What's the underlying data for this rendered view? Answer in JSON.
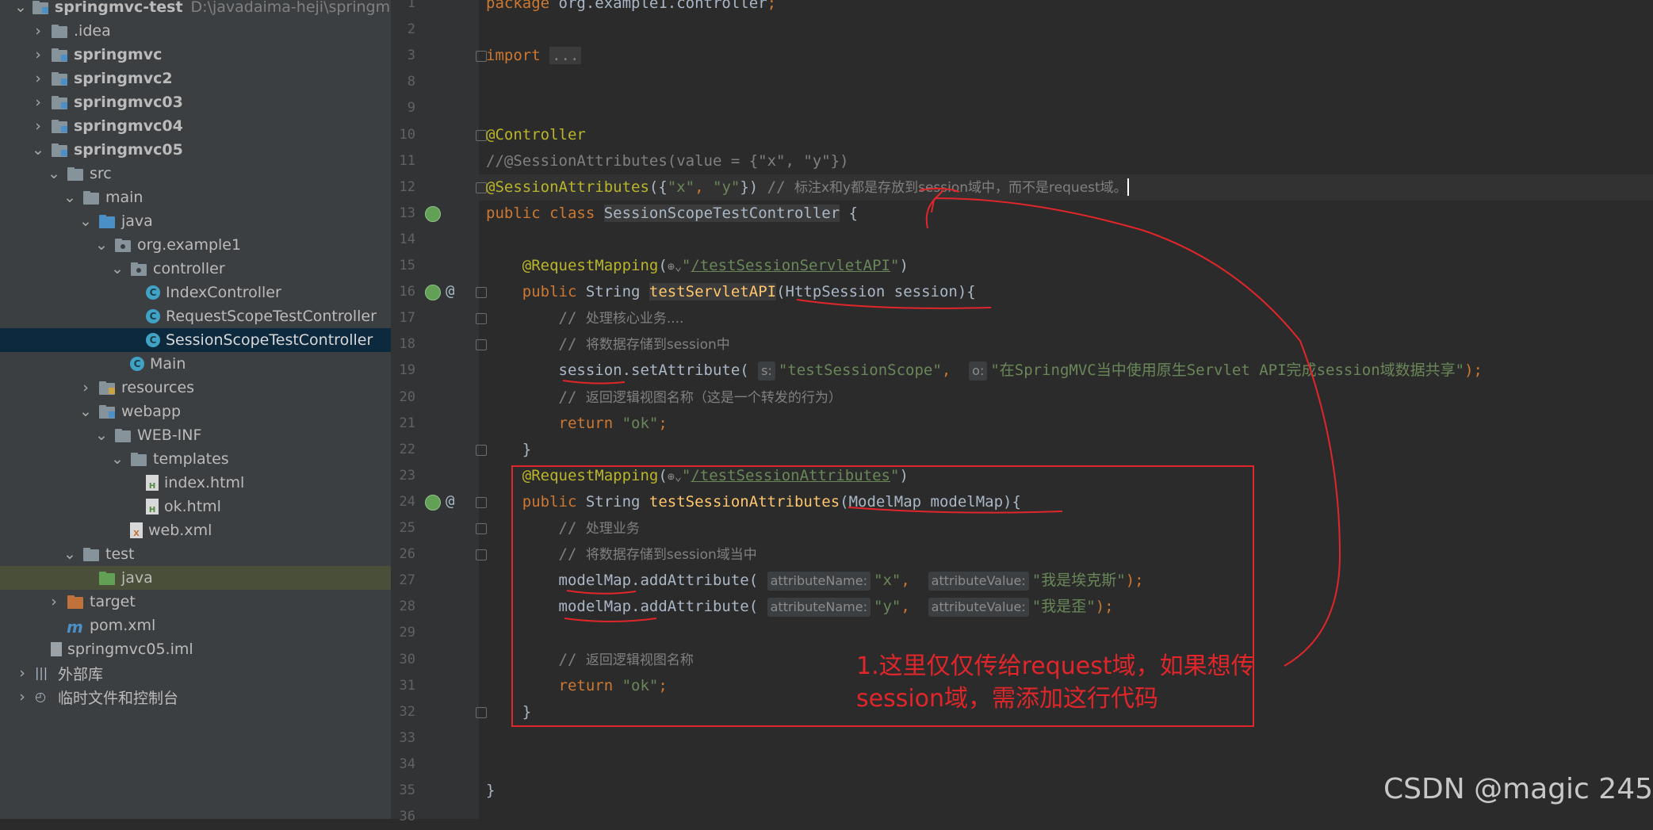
{
  "project_tree": {
    "items": [
      {
        "label": "springmvc-test",
        "path": "D:\\javadaima-heji\\springmvc-test",
        "icon": "module-folder-icon",
        "arrow": "down",
        "depth": 0,
        "bold": true
      },
      {
        "label": ".idea",
        "icon": "folder-icon",
        "arrow": "right",
        "depth": 1
      },
      {
        "label": "springmvc",
        "icon": "module-folder-icon",
        "arrow": "right",
        "depth": 1,
        "bold": true
      },
      {
        "label": "springmvc2",
        "icon": "module-folder-icon",
        "arrow": "right",
        "depth": 1,
        "bold": true
      },
      {
        "label": "springmvc03",
        "icon": "module-folder-icon",
        "arrow": "right",
        "depth": 1,
        "bold": true
      },
      {
        "label": "springmvc04",
        "icon": "module-folder-icon",
        "arrow": "right",
        "depth": 1,
        "bold": true
      },
      {
        "label": "springmvc05",
        "icon": "module-folder-icon",
        "arrow": "down",
        "depth": 1,
        "bold": true
      },
      {
        "label": "src",
        "icon": "folder-icon",
        "arrow": "down",
        "depth": 2
      },
      {
        "label": "main",
        "icon": "folder-icon",
        "arrow": "down",
        "depth": 3
      },
      {
        "label": "java",
        "icon": "source-folder-icon",
        "arrow": "down",
        "depth": 4
      },
      {
        "label": "org.example1",
        "icon": "package-icon",
        "arrow": "down",
        "depth": 5
      },
      {
        "label": "controller",
        "icon": "package-icon",
        "arrow": "down",
        "depth": 6
      },
      {
        "label": "IndexController",
        "icon": "class-icon",
        "arrow": "none",
        "depth": 7
      },
      {
        "label": "RequestScopeTestController",
        "icon": "class-icon",
        "arrow": "none",
        "depth": 7
      },
      {
        "label": "SessionScopeTestController",
        "icon": "class-icon",
        "arrow": "none",
        "depth": 7,
        "selected": true
      },
      {
        "label": "Main",
        "icon": "class-icon",
        "arrow": "none",
        "depth": 6
      },
      {
        "label": "resources",
        "icon": "resources-folder-icon",
        "arrow": "right",
        "depth": 4
      },
      {
        "label": "webapp",
        "icon": "web-folder-icon",
        "arrow": "down",
        "depth": 4
      },
      {
        "label": "WEB-INF",
        "icon": "folder-icon",
        "arrow": "down",
        "depth": 5
      },
      {
        "label": "templates",
        "icon": "folder-icon",
        "arrow": "down",
        "depth": 6
      },
      {
        "label": "index.html",
        "icon": "html-file-icon",
        "arrow": "none",
        "depth": 7
      },
      {
        "label": "ok.html",
        "icon": "html-file-icon",
        "arrow": "none",
        "depth": 7
      },
      {
        "label": "web.xml",
        "icon": "xml-file-icon",
        "arrow": "none",
        "depth": 6
      },
      {
        "label": "test",
        "icon": "folder-icon",
        "arrow": "down",
        "depth": 3
      },
      {
        "label": "java",
        "icon": "test-folder-icon",
        "arrow": "none",
        "depth": 4,
        "highlight": true
      },
      {
        "label": "target",
        "icon": "excluded-folder-icon",
        "arrow": "right",
        "depth": 2
      },
      {
        "label": "pom.xml",
        "icon": "maven-file-icon",
        "arrow": "none",
        "depth": 2
      },
      {
        "label": "springmvc05.iml",
        "icon": "iml-file-icon",
        "arrow": "none",
        "depth": 1
      },
      {
        "label": "外部库",
        "icon": "library-icon",
        "arrow": "right",
        "depth": 0
      },
      {
        "label": "临时文件和控制台",
        "icon": "scratches-icon",
        "arrow": "right",
        "depth": 0
      }
    ]
  },
  "editor": {
    "lines": [
      {
        "n": "1",
        "html": "<span class=\"kw\">package</span> org.example1.controller<span class=\"kw\">;</span>"
      },
      {
        "n": "2",
        "html": ""
      },
      {
        "n": "3",
        "html": "<span class=\"kw\">import</span> <span class=\"collapsed-dots\">...</span>"
      },
      {
        "n": "8",
        "html": ""
      },
      {
        "n": "9",
        "html": ""
      },
      {
        "n": "10",
        "html": "<span class=\"ann\">@Controller</span>"
      },
      {
        "n": "11",
        "html": "<span class=\"cmt\">//@SessionAttributes(value = {\"x\", \"y\"})</span>"
      },
      {
        "n": "12",
        "html": "<span class=\"ann\">@SessionAttributes</span>({<span class=\"str\">\"x\"</span><span class=\"kw\">, </span><span class=\"str\">\"y\"</span>}) <span class=\"cmt\">// </span><span class=\"cmt-zh\">标注x和y都是存放到session域中，而不是request域。</span><span class=\"caret\"></span>"
      },
      {
        "n": "13",
        "html": "<span class=\"kw\">public class</span> <span class=\"hl2\">SessionScopeTestController</span> {"
      },
      {
        "n": "14",
        "html": ""
      },
      {
        "n": "15",
        "html": "    <span class=\"ann\">@RequestMapping</span>(<span class=\"globe\">⊕⌄</span><span class=\"str\">\"</span><span class=\"url\">/testSessionServletAPI</span><span class=\"str\">\"</span>)"
      },
      {
        "n": "16",
        "html": "    <span class=\"kw\">public</span> String <span class=\"fn hl2\">testServletAPI</span>(HttpSession session){"
      },
      {
        "n": "17",
        "html": "        <span class=\"cmt\">// </span><span class=\"cmt-zh\">处理核心业务....</span>"
      },
      {
        "n": "18",
        "html": "        <span class=\"cmt\">// </span><span class=\"cmt-zh\">将数据存储到session中</span>"
      },
      {
        "n": "19",
        "html": "        session.setAttribute( <span class=\"hint\">s:</span><span class=\"str\">\"testSessionScope\"</span><span class=\"kw\">, </span> <span class=\"hint\">o:</span><span class=\"str\">\"在SpringMVC当中使用原生Servlet API完成session域数据共享\"</span><span class=\"kw\">);</span>"
      },
      {
        "n": "20",
        "html": "        <span class=\"cmt\">// </span><span class=\"cmt-zh\">返回逻辑视图名称（这是一个转发的行为）</span>"
      },
      {
        "n": "21",
        "html": "        <span class=\"kw\">return</span> <span class=\"str\">\"ok\"</span><span class=\"kw\">;</span>"
      },
      {
        "n": "22",
        "html": "    }"
      },
      {
        "n": "23",
        "html": "    <span class=\"ann\">@RequestMapping</span>(<span class=\"globe\">⊕⌄</span><span class=\"str\">\"</span><span class=\"url\">/testSessionAttributes</span><span class=\"str\">\"</span>)"
      },
      {
        "n": "24",
        "html": "    <span class=\"kw\">public</span> String <span class=\"fn\">testSessionAttributes</span>(ModelMap modelMap){"
      },
      {
        "n": "25",
        "html": "        <span class=\"cmt\">// </span><span class=\"cmt-zh\">处理业务</span>"
      },
      {
        "n": "26",
        "html": "        <span class=\"cmt\">// </span><span class=\"cmt-zh\">将数据存储到session域当中</span>"
      },
      {
        "n": "27",
        "html": "        modelMap.addAttribute( <span class=\"hint\">attributeName:</span><span class=\"str\">\"x\"</span><span class=\"kw\">, </span> <span class=\"hint\">attributeValue:</span><span class=\"str\">\"我是埃克斯\"</span><span class=\"kw\">);</span>"
      },
      {
        "n": "28",
        "html": "        modelMap.addAttribute( <span class=\"hint\">attributeName:</span><span class=\"str\">\"y\"</span><span class=\"kw\">, </span> <span class=\"hint\">attributeValue:</span><span class=\"str\">\"我是歪\"</span><span class=\"kw\">);</span>"
      },
      {
        "n": "29",
        "html": ""
      },
      {
        "n": "30",
        "html": "        <span class=\"cmt\">// </span><span class=\"cmt-zh\">返回逻辑视图名称</span>"
      },
      {
        "n": "31",
        "html": "        <span class=\"kw\">return</span> <span class=\"str\">\"ok\"</span><span class=\"kw\">;</span>"
      },
      {
        "n": "32",
        "html": "    }"
      },
      {
        "n": "33",
        "html": ""
      },
      {
        "n": "34",
        "html": ""
      },
      {
        "n": "35",
        "html": "}"
      },
      {
        "n": "36",
        "html": ""
      }
    ]
  },
  "annotation": {
    "text": "1.这里仅仅传给request域，如果想传session域，需添加这行代码",
    "color": "#e0262b"
  },
  "watermark": "CSDN @magic 245",
  "colors": {
    "sidebar_bg": "#3c3f41",
    "editor_bg": "#2b2b2b",
    "selection": "#0d293e",
    "keyword": "#cc7832",
    "annotation": "#bbb529",
    "string": "#6a8759",
    "comment": "#808080"
  }
}
